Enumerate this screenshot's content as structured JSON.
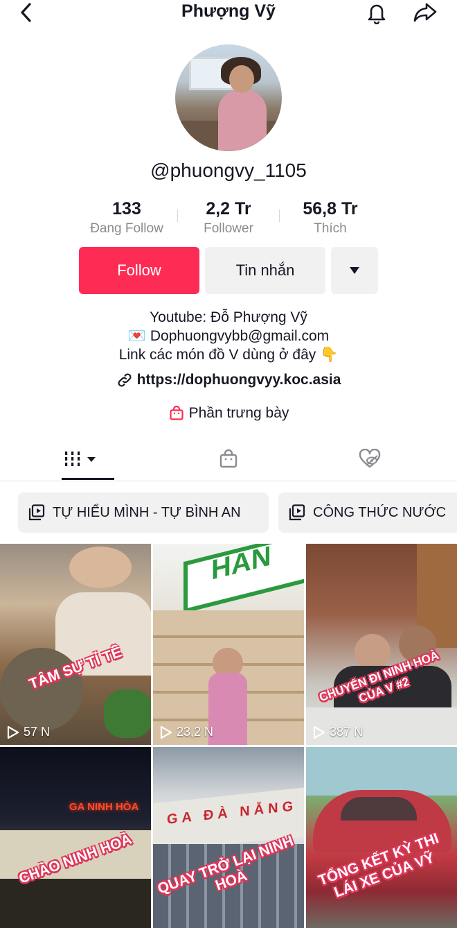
{
  "header": {
    "title": "Phượng Vỹ"
  },
  "profile": {
    "handle": "@phuongvy_1105",
    "stats": [
      {
        "value": "133",
        "label": "Đang Follow"
      },
      {
        "value": "2,2 Tr",
        "label": "Follower"
      },
      {
        "value": "56,8 Tr",
        "label": "Thích"
      }
    ],
    "buttons": {
      "follow": "Follow",
      "message": "Tin nhắn"
    },
    "bio": {
      "line1": "Youtube: Đỗ Phượng Vỹ",
      "line2_emoji": "💌",
      "line2": "Dophuongvybb@gmail.com",
      "line3": "Link các món đồ V dùng ở đây",
      "line3_emoji": "👇"
    },
    "link": "https://dophuongvyy.koc.asia",
    "showcase": "Phần trưng bày"
  },
  "tabs": [
    {
      "icon": "videos-grid-icon",
      "selected": true
    },
    {
      "icon": "shopping-bag-icon",
      "selected": false
    },
    {
      "icon": "liked-hidden-icon",
      "selected": false
    }
  ],
  "playlists": [
    {
      "label": "TỰ HIỂU MÌNH - TỰ BÌNH AN"
    },
    {
      "label": "CÔNG THỨC NƯỚC"
    }
  ],
  "videos": [
    {
      "caption": "TÂM SỰ TỈ TÊ",
      "views": "57 N"
    },
    {
      "caption": "",
      "views": "23,2 N"
    },
    {
      "caption": "CHUYẾN ĐI NINH HOÀ CỦA V #2",
      "views": "387 N"
    },
    {
      "caption": "CHÀO NINH HOÀ",
      "views": ""
    },
    {
      "caption": "QUAY TRỞ LẠI NINH HOÀ",
      "views": ""
    },
    {
      "caption": "TỔNG KẾT KỲ THI LÁI XE CỦA VỸ",
      "views": ""
    }
  ],
  "video_sign_text": {
    "store_sign": "HÀN",
    "station_ninhhoa": "GA NINH HÒA",
    "station_danang": "GA ĐÀ NẴNG"
  },
  "colors": {
    "accent": "#fe2c55",
    "text": "#161823",
    "muted": "#8a8b91",
    "button_bg": "#f1f1f2"
  }
}
